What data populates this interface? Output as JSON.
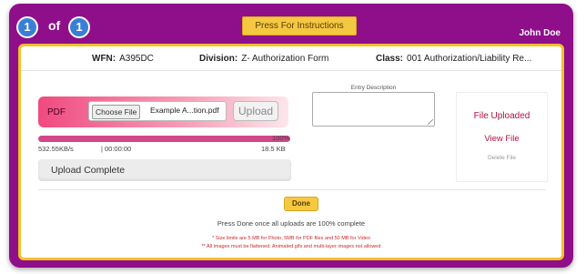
{
  "pager": {
    "current": "1",
    "of_label": "of",
    "total": "1"
  },
  "header": {
    "instructions_button": "Press For Instructions",
    "user": "John Doe"
  },
  "info": {
    "wfn_label": "WFN:",
    "wfn_value": "A395DC",
    "division_label": "Division:",
    "division_value": "Z- Authorization Form",
    "class_label": "Class:",
    "class_value": "001 Authorization/Liability Re..."
  },
  "upload": {
    "type_label": "PDF",
    "choose_file_label": "Choose File",
    "file_name": "Example A...tion.pdf",
    "upload_button": "Upload",
    "progress_percent": 100,
    "progress_label": "100%",
    "speed": "532.55KB/s",
    "elapsed": "00:00:00",
    "size": "18.5 KB",
    "status": "Upload Complete"
  },
  "description": {
    "label": "Entry Description",
    "value": ""
  },
  "file_panel": {
    "uploaded": "File Uploaded",
    "view": "View File",
    "delete": "Delete File"
  },
  "footer": {
    "done_button": "Done",
    "hint": "Press Done once all uploads are 100% complete",
    "note1": "* Size limits are 5 MB for Photo, 5MB for PDF files and 50 MB for Video",
    "note2": "** All images must be flattened. Animated gifs and multi-layer images not allowed"
  },
  "colors": {
    "frame": "#8f0e8a",
    "panel_border": "#f3c12a",
    "accent_button": "#f5c842",
    "pager_circle": "#3a7fd5",
    "progress": "#d1478a",
    "link": "#b0123e"
  }
}
